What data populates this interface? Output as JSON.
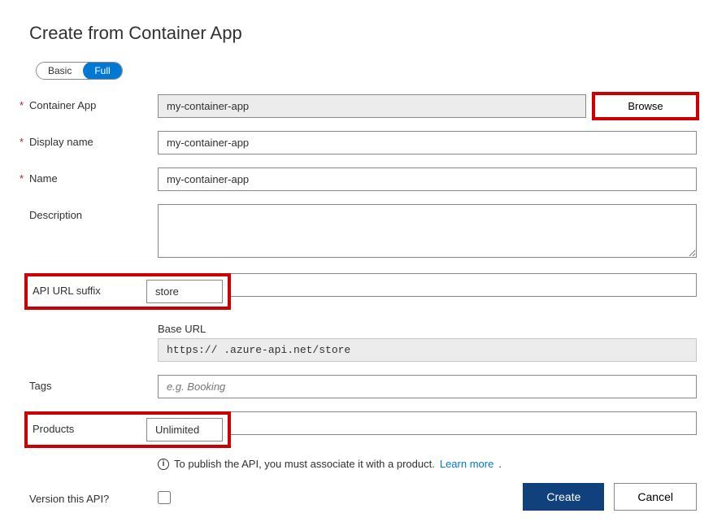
{
  "page_title": "Create from Container App",
  "toggle": {
    "basic": "Basic",
    "full": "Full",
    "selected": "Full"
  },
  "fields": {
    "container_app": {
      "label": "Container App",
      "value": "my-container-app",
      "browse": "Browse"
    },
    "display_name": {
      "label": "Display name",
      "value": "my-container-app"
    },
    "name": {
      "label": "Name",
      "value": "my-container-app"
    },
    "description": {
      "label": "Description",
      "value": ""
    },
    "api_url_suffix": {
      "label": "API URL suffix",
      "value": "store"
    },
    "base_url": {
      "label": "Base URL",
      "value": "https://            .azure-api.net/store"
    },
    "tags": {
      "label": "Tags",
      "placeholder": "e.g. Booking",
      "value": ""
    },
    "products": {
      "label": "Products",
      "value": "Unlimited"
    },
    "products_info": {
      "text": "To publish the API, you must associate it with a product.",
      "link": "Learn more"
    },
    "version": {
      "label": "Version this API?"
    }
  },
  "footer": {
    "create": "Create",
    "cancel": "Cancel"
  }
}
